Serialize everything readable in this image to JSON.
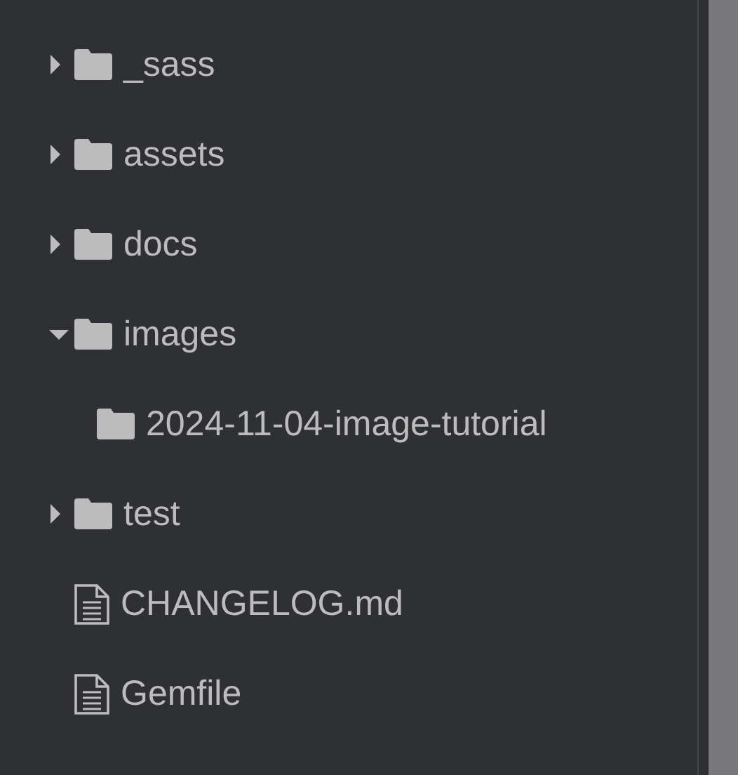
{
  "file_tree": [
    {
      "kind": "folder",
      "name": "_sass",
      "expanded": false
    },
    {
      "kind": "folder",
      "name": "assets",
      "expanded": false
    },
    {
      "kind": "folder",
      "name": "docs",
      "expanded": false
    },
    {
      "kind": "folder",
      "name": "images",
      "expanded": true,
      "children": [
        {
          "kind": "folder",
          "name": "2024-11-04-image-tutorial"
        }
      ]
    },
    {
      "kind": "folder",
      "name": "test",
      "expanded": false
    },
    {
      "kind": "file",
      "name": "CHANGELOG.md"
    },
    {
      "kind": "file",
      "name": "Gemfile"
    }
  ]
}
